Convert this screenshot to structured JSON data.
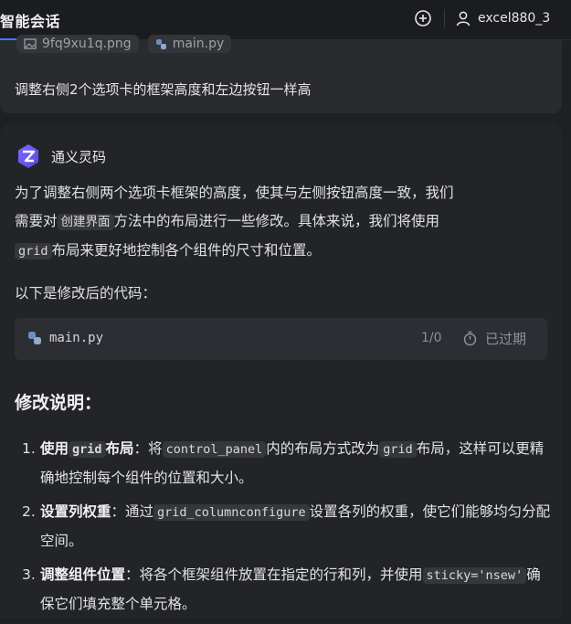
{
  "topbar": {
    "title": "智能会话",
    "username": "excel880_3",
    "add_icon": "plus-circle-icon",
    "user_icon": "user-icon"
  },
  "user_message": {
    "attachments": [
      "9fq9xu1q.png",
      "main.py"
    ],
    "text": "调整右侧2个选项卡的框架高度和左边按钮一样高"
  },
  "ai_response": {
    "assistant_name": "通义灵码",
    "intro": {
      "p1_a": "为了调整右侧两个选项卡框架的高度，使其与左侧按钮高度一致，我们",
      "p1_b": "需要对",
      "p1_code1": "创建界面",
      "p1_c": "方法中的布局进行一些修改。具体来说，我们将使用",
      "p1_code2": "grid",
      "p1_d": "布局来更好地控制各个组件的尺寸和位置。"
    },
    "code_intro": "以下是修改后的代码：",
    "code_file": {
      "name": "main.py",
      "count": "1/0",
      "status": "已过期"
    },
    "section_title": "修改说明：",
    "items": [
      {
        "num": "1.",
        "bold1": "使用",
        "code_bold": "grid",
        "bold2": "布局",
        "text1": "：将",
        "code": "control_panel",
        "text2": "内的布局方式改为",
        "code2": "grid",
        "text3": "布局，这样可以更精确地控制每个组件的位置和大小。"
      },
      {
        "num": "2.",
        "bold": "设置列权重",
        "text1": "：通过",
        "code": "grid_columnconfigure",
        "text2": "设置各列的权重，使它们能够均匀分配空间。"
      },
      {
        "num": "3.",
        "bold": "调整组件位置",
        "text1": "：将各个框架组件放置在指定的行和列，并使用",
        "code": "sticky='nsew'",
        "text2": "确保它们填充整个单元格。"
      }
    ]
  },
  "colors": {
    "background": "#1f2023",
    "card": "#232428",
    "accent": "#3d7bfd"
  }
}
